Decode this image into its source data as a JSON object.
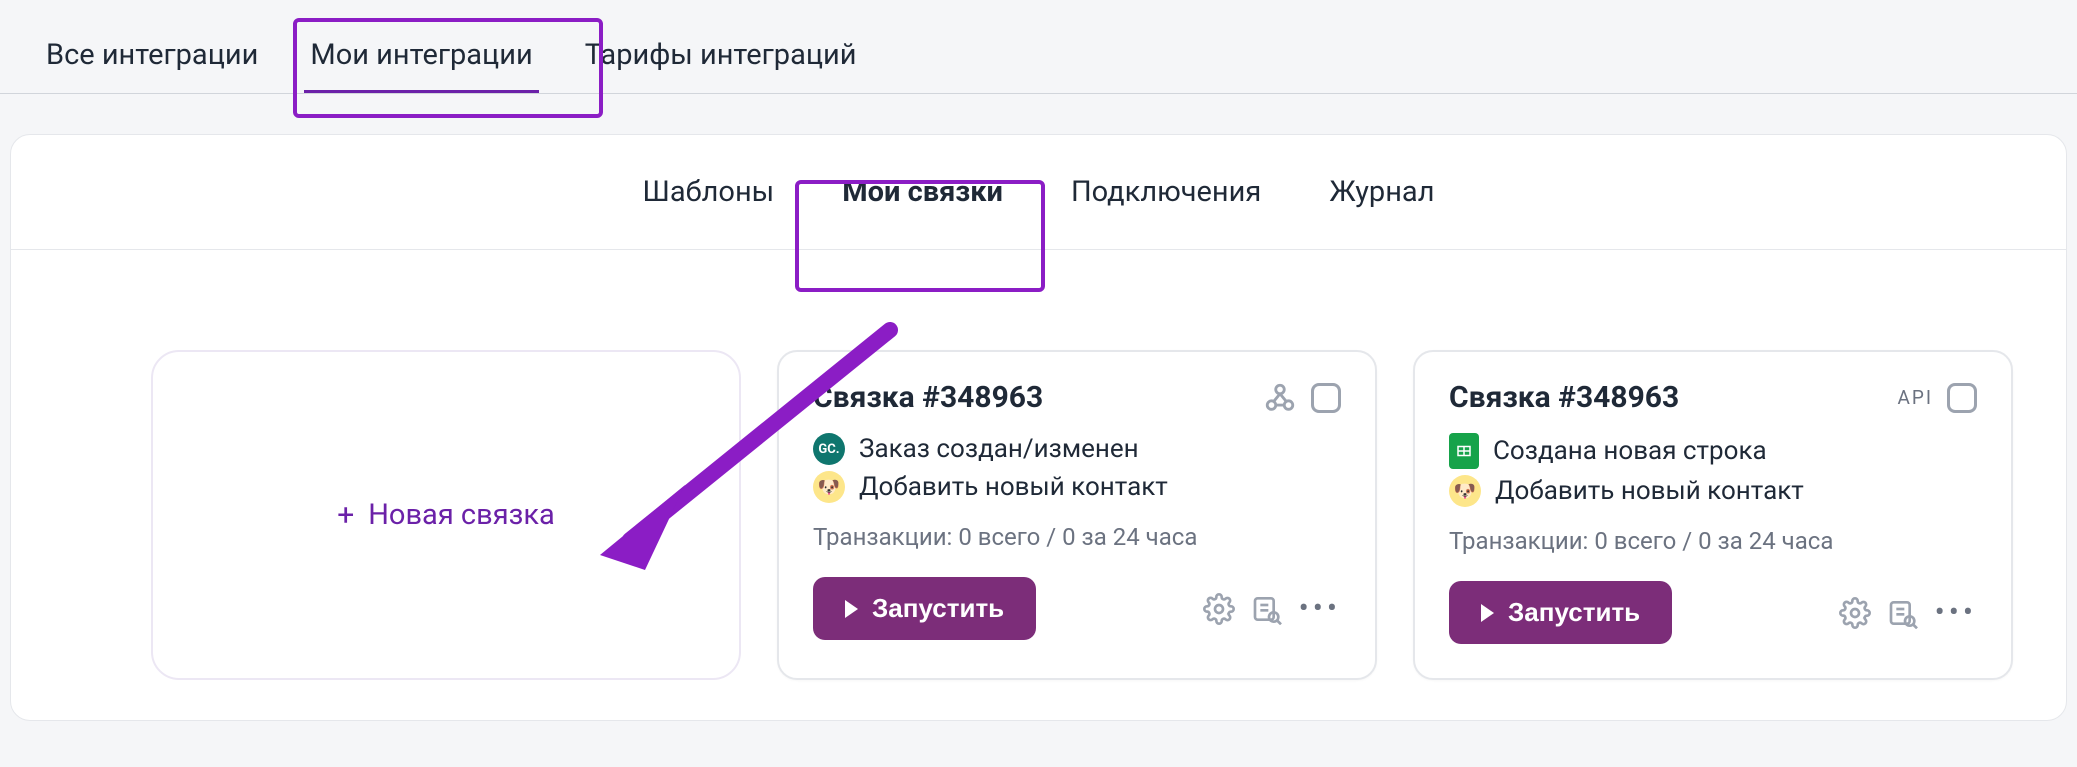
{
  "top_tabs": {
    "all": "Все интеграции",
    "mine": "Мои интеграции",
    "tariffs": "Тарифы интеграций"
  },
  "inner_tabs": {
    "templates": "Шаблоны",
    "my_links": "Мои связки",
    "connections": "Подключения",
    "journal": "Журнал"
  },
  "new_card_label": "Новая связка",
  "cards": [
    {
      "title": "Связка #348963",
      "badge": "",
      "step1": "Заказ создан/изменен",
      "step2": "Добавить новый контакт",
      "transactions": "Транзакции: 0 всего / 0 за 24 часа",
      "run": "Запустить",
      "has_webhook_icon": true
    },
    {
      "title": "Связка #348963",
      "badge": "API",
      "step1": "Создана новая строка",
      "step2": "Добавить новый контакт",
      "transactions": "Транзакции: 0 всего / 0 за 24 часа",
      "run": "Запустить",
      "has_webhook_icon": false
    }
  ]
}
